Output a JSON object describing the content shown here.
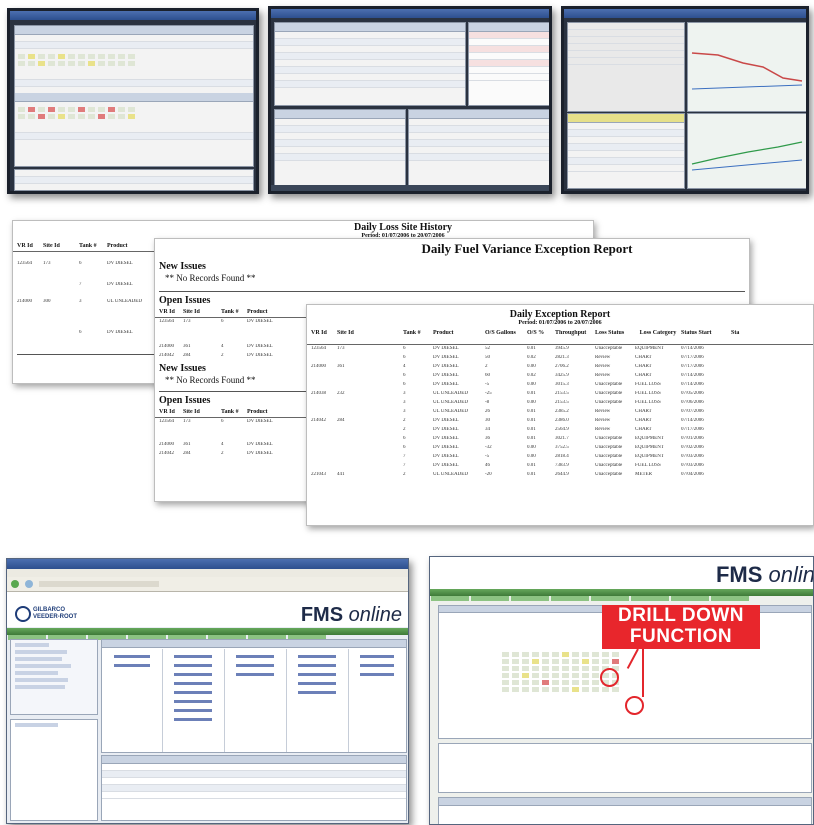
{
  "loss_history": {
    "title": "Daily Loss Site History",
    "period": "Period: 01/07/2006 to 20/07/2006",
    "columns": [
      "VR Id",
      "Site Id",
      "Tank #",
      "Product"
    ],
    "rows": [
      [
        "123564",
        "173",
        "6",
        "DV DIESEL"
      ],
      [
        "",
        "",
        "7",
        "DV DIESEL"
      ],
      [
        "214000",
        "300",
        "3",
        "UL UNLEADED"
      ],
      [
        "",
        "",
        "6",
        "DV DIESEL"
      ]
    ]
  },
  "fuel_variance": {
    "title": "Daily Fuel Variance Exception Report",
    "new_issues": "New Issues",
    "no_records": "** No Records Found **",
    "open_issues": "Open Issues",
    "columns": [
      "VR Id",
      "Site Id",
      "Tank #",
      "Product"
    ],
    "rows": [
      [
        "123564",
        "173",
        "6",
        "DV DIESEL"
      ],
      [
        "214000",
        "361",
        "4",
        "DV DIESEL"
      ],
      [
        "214042",
        "284",
        "2",
        "DV DIESEL"
      ]
    ]
  },
  "exception_report": {
    "title": "Daily Exception Report",
    "period": "Period: 01/07/2006 to 20/07/2006",
    "columns": [
      "VR Id",
      "Site Id",
      "Tank #",
      "Product",
      "O/S Gallons",
      "O/S %",
      "Throughput",
      "Loss Status",
      "Loss Category",
      "Status Start",
      "Sta"
    ],
    "rows": [
      [
        "123564",
        "173",
        "6",
        "DV DIESEL",
        "52",
        "0.01",
        "3945.9",
        "Unacceptable",
        "EQUIPMENT",
        "07/14/2006",
        ""
      ],
      [
        "",
        "",
        "6",
        "DV DIESEL",
        "50",
        "0.02",
        "2821.3",
        "Review",
        "CHART",
        "07/17/2006",
        ""
      ],
      [
        "214000",
        "361",
        "4",
        "DV DIESEL",
        "2",
        "0.00",
        "2706.2",
        "Review",
        "CHART",
        "07/17/2006",
        ""
      ],
      [
        "",
        "",
        "6",
        "DV DIESEL",
        "60",
        "0.02",
        "3425.9",
        "Review",
        "CHART",
        "07/14/2006",
        ""
      ],
      [
        "",
        "",
        "6",
        "DV DIESEL",
        "-5",
        "0.00",
        "3015.3",
        "Unacceptable",
        "FUEL LOSS",
        "07/14/2006",
        ""
      ],
      [
        "214038",
        "232",
        "3",
        "UL UNLEADED",
        "-25",
        "0.01",
        "2153.5",
        "Unacceptable",
        "FUEL LOSS",
        "07/05/2006",
        ""
      ],
      [
        "",
        "",
        "3",
        "UL UNLEADED",
        "-8",
        "0.00",
        "2153.5",
        "Unacceptable",
        "FUEL LOSS",
        "07/06/2006",
        ""
      ],
      [
        "",
        "",
        "3",
        "UL UNLEADED",
        "26",
        "0.01",
        "2385.2",
        "Review",
        "CHART",
        "07/07/2006",
        ""
      ],
      [
        "214042",
        "284",
        "2",
        "DV DIESEL",
        "30",
        "0.01",
        "2386.0",
        "Review",
        "CHART",
        "07/14/2006",
        ""
      ],
      [
        "",
        "",
        "2",
        "DV DIESEL",
        "34",
        "0.01",
        "2564.9",
        "Review",
        "CHART",
        "07/17/2006",
        ""
      ],
      [
        "",
        "",
        "6",
        "DV DIESEL",
        "36",
        "0.01",
        "3021.7",
        "Unacceptable",
        "EQUIPMENT",
        "07/01/2006",
        ""
      ],
      [
        "",
        "",
        "6",
        "DV DIESEL",
        "-32",
        "0.00",
        "3752.5",
        "Unacceptable",
        "EQUIPMENT",
        "07/02/2006",
        ""
      ],
      [
        "",
        "",
        "7",
        "DV DIESEL",
        "-5",
        "0.00",
        "2818.4",
        "Unacceptable",
        "EQUIPMENT",
        "07/03/2006",
        ""
      ],
      [
        "",
        "",
        "7",
        "DV DIESEL",
        "46",
        "0.01",
        "7383.9",
        "Unacceptable",
        "FUEL LOSS",
        "07/03/2006",
        ""
      ],
      [
        "221043",
        "441",
        "2",
        "UL UNLEADED",
        "-20",
        "0.01",
        "2644.9",
        "Unacceptable",
        "METER",
        "07/04/2006",
        ""
      ]
    ]
  },
  "fms_portal": {
    "brand_prefix": "FMS",
    "brand_suffix": "online",
    "company_line_1": "GILBARCO",
    "company_line_2": "VEEDER-ROOT"
  },
  "fms_drill": {
    "brand_prefix": "FMS",
    "brand_suffix": "onlin",
    "callout_line_1": "DRILL DOWN",
    "callout_line_2": "FUNCTION"
  }
}
